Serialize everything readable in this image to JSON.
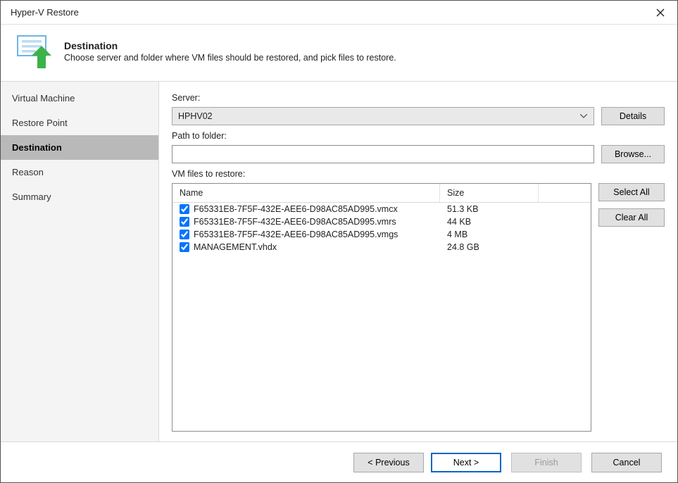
{
  "window": {
    "title": "Hyper-V Restore"
  },
  "header": {
    "title": "Destination",
    "subtitle": "Choose server and folder where VM files should be restored, and pick files to restore."
  },
  "sidebar": {
    "items": [
      {
        "label": "Virtual Machine"
      },
      {
        "label": "Restore Point"
      },
      {
        "label": "Destination"
      },
      {
        "label": "Reason"
      },
      {
        "label": "Summary"
      }
    ],
    "active_index": 2
  },
  "main": {
    "server_label": "Server:",
    "server_value": "HPHV02",
    "details_label": "Details",
    "path_label": "Path to folder:",
    "path_value": "",
    "browse_label": "Browse...",
    "files_label": "VM files to restore:",
    "col_name": "Name",
    "col_size": "Size",
    "select_all_label": "Select All",
    "clear_all_label": "Clear All",
    "files": [
      {
        "checked": true,
        "name": "F65331E8-7F5F-432E-AEE6-D98AC85AD995.vmcx",
        "size": "51.3 KB"
      },
      {
        "checked": true,
        "name": "F65331E8-7F5F-432E-AEE6-D98AC85AD995.vmrs",
        "size": "44 KB"
      },
      {
        "checked": true,
        "name": "F65331E8-7F5F-432E-AEE6-D98AC85AD995.vmgs",
        "size": "4 MB"
      },
      {
        "checked": true,
        "name": "MANAGEMENT.vhdx",
        "size": "24.8 GB"
      }
    ]
  },
  "footer": {
    "previous": "< Previous",
    "next": "Next >",
    "finish": "Finish",
    "cancel": "Cancel"
  }
}
